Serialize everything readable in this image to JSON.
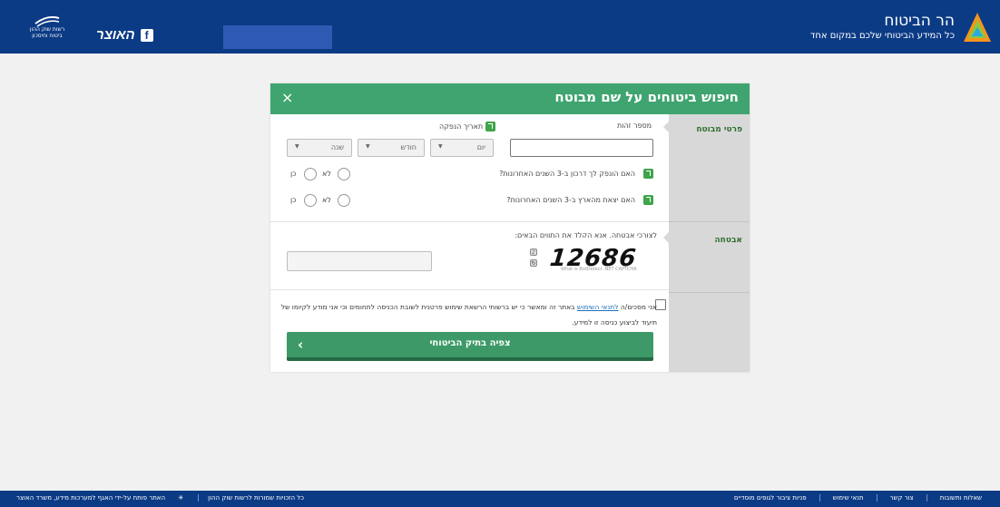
{
  "header": {
    "brand_title": "הר הביטוח",
    "brand_subtitle": "כל המידע הביטוחי שלכם במקום אחד",
    "treasury_label": "האוצר",
    "fb_label": "f",
    "gov_logo_text_line1": "רשות שוק ההון",
    "gov_logo_text_line2": "ביטוח וחיסכון"
  },
  "modal": {
    "title": "חיפוש ביטוחים על שם מבוטח",
    "close": "×",
    "sections": {
      "insured_details": "פרטי מבוטח",
      "security": "אבטחה"
    },
    "id_label": "מספר זהות",
    "issue_date_label": "תאריך הנפקה",
    "date_selects": {
      "day": "יום",
      "month": "חודש",
      "year": "שנה"
    },
    "question_passport": "האם הונפק לך דרכון ב-3 השנים האחרונות?",
    "question_travel": "האם יצאת מהארץ ב-3 השנים האחרונות?",
    "radio_no": "לא",
    "radio_yes": "כן",
    "captcha_prompt": "לצורכי אבטחה, אנא הקלד את התווים הבאים:",
    "captcha_value": "12686",
    "captcha_note": "What is BotDetect .NET CAPTCHA",
    "terms_before": "אני מסכים/ה",
    "terms_link": "לתנאי השימוש",
    "terms_after": "באתר זה ומאשר כי יש ברשותי הרשאת שימוש פרטנית לשובת הכניסה לתחומים וכי אני מודע לקיומו של תיעוד לביצוע כניסה זו למידע.",
    "submit_label": "צפיה בתיק הביטוחי",
    "submit_arrow": "‹"
  },
  "footer": {
    "links": [
      "שאלות ותשובות",
      "צור קשר",
      "תנאי שימוש",
      "פניות ציבור לגופים מוסדיים"
    ],
    "rights": "כל הזכויות שמורות לרשות שוק ההון",
    "developed": "האתר פותח על-ידי האגף למערכות מידע, משרד האוצר"
  },
  "colors": {
    "header": "#0c3b85",
    "modal_header": "#3fa46f",
    "submit": "#3d9a68",
    "side_panel": "#d8d8d8"
  }
}
